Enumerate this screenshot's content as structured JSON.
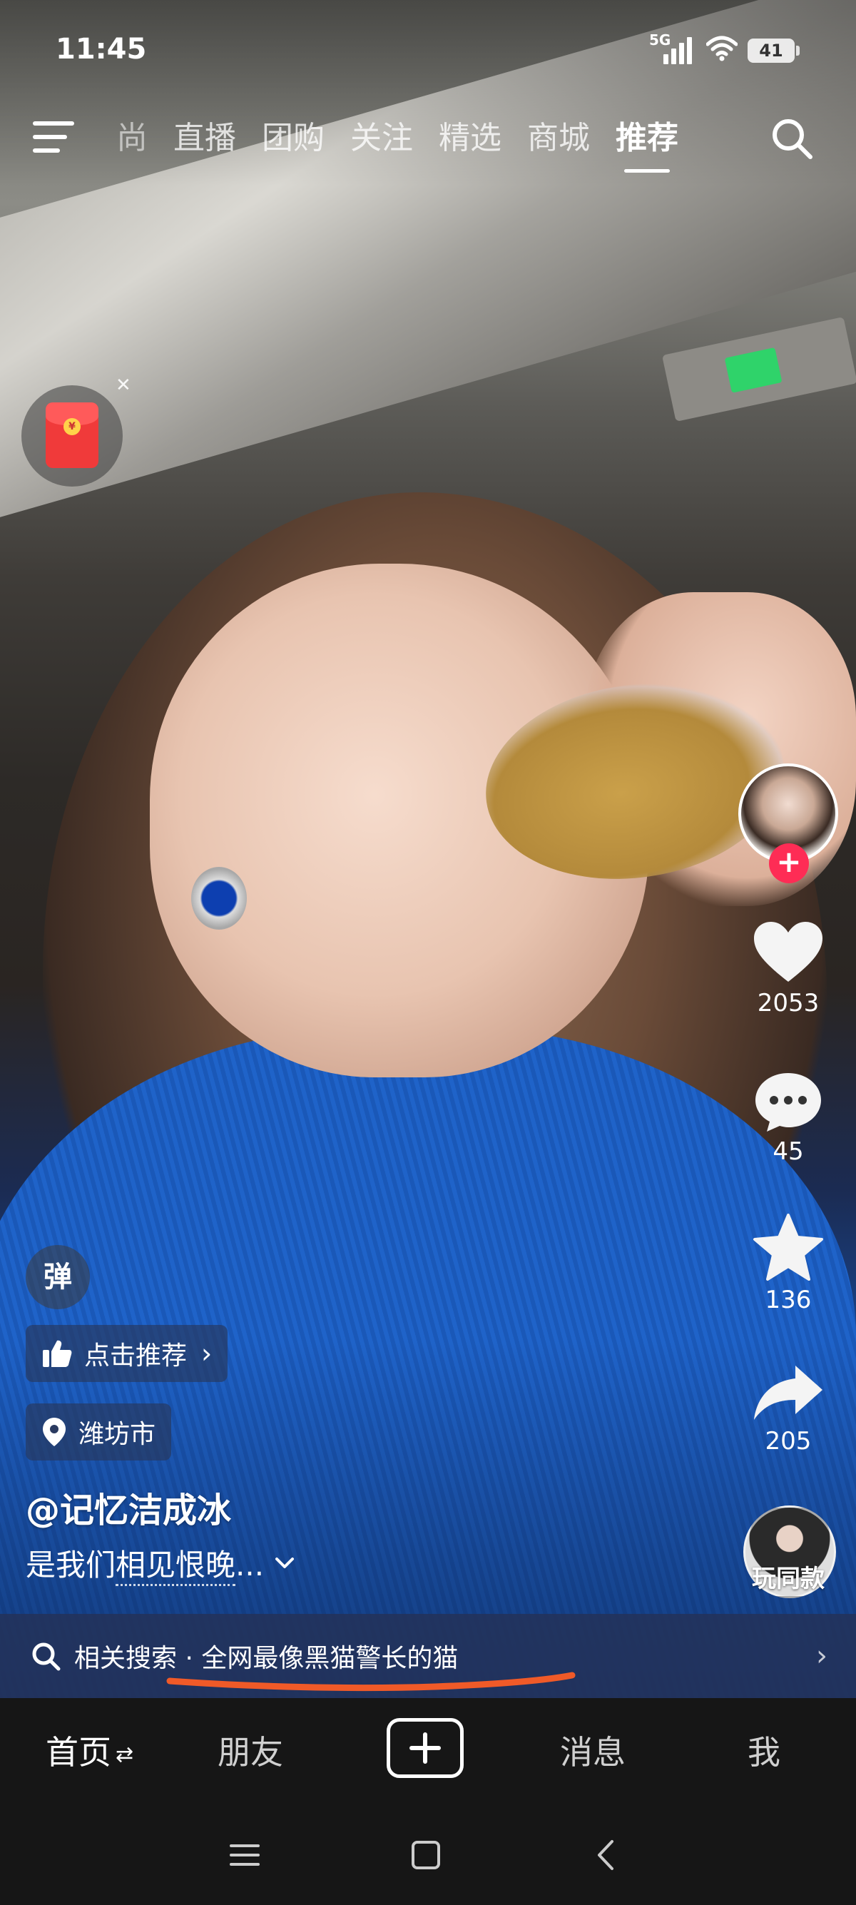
{
  "status_bar": {
    "time": "11:45",
    "network": "5G",
    "battery": "41"
  },
  "top_nav": {
    "tabs": [
      "尚",
      "直播",
      "团购",
      "关注",
      "精选",
      "商城",
      "推荐"
    ],
    "active_tab": "推荐"
  },
  "right_rail": {
    "likes": "2053",
    "comments": "45",
    "favorites": "136",
    "shares": "205",
    "play_same": "玩同款"
  },
  "video_info": {
    "danmu": "弹",
    "recommend_chip": "点击推荐",
    "location": "潍坊市",
    "username": "@记忆洁成冰",
    "caption": "是我们相见恨晚...",
    "caption_prefix": "是我们",
    "caption_underlined": "相见恨晚",
    "caption_suffix": "..."
  },
  "related_search": {
    "prefix": "相关搜索",
    "separator": "·",
    "query": "全网最像黑猫警长的猫"
  },
  "bottom_tabs": {
    "home": "首页",
    "friends": "朋友",
    "messages": "消息",
    "me": "我"
  },
  "colors": {
    "accent": "#fe2c55",
    "annotation": "#f05a28",
    "bar_bg": "#161616"
  },
  "icons": {
    "menu": "menu-icon",
    "search": "search-icon",
    "like": "heart-icon",
    "comment": "comment-icon",
    "favorite": "star-icon",
    "share": "share-icon",
    "location": "location-pin-icon",
    "thumb": "thumbs-up-icon"
  }
}
